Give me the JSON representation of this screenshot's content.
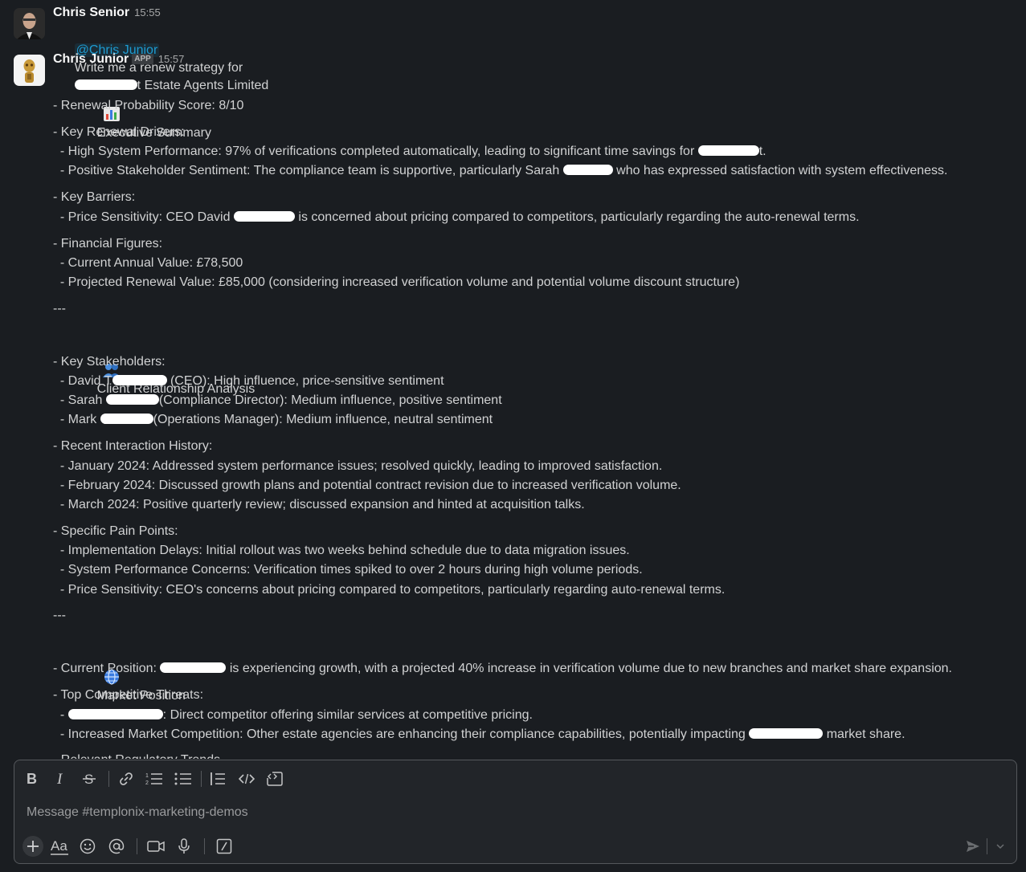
{
  "messages": [
    {
      "author": "Chris Senior",
      "time": "15:55",
      "mention": "@Chris Junior",
      "text_before": "Write me a renew strategy for",
      "text_after": "t Estate Agents Limited"
    },
    {
      "author": "Chris Junior",
      "badge": "APP",
      "time": "15:57",
      "exec_title": "Executive Summary",
      "exec_icon": "bar-chart-emoji",
      "l_prob": "- Renewal Probability Score: 8/10",
      "l_drivers": "- Key Renewal Drivers:",
      "l_driver1_a": "  - High System Performance: 97% of verifications completed automatically, leading to significant time savings for",
      "l_driver1_b": "t.",
      "l_driver2_a": "  - Positive Stakeholder Sentiment: The compliance team is supportive, particularly Sarah",
      "l_driver2_b": " who has expressed satisfaction with system effectiveness.",
      "l_barriers": "- Key Barriers:",
      "l_barrier1_a": "  - Price Sensitivity: CEO David",
      "l_barrier1_b": " is concerned about pricing compared to competitors, particularly regarding the auto-renewal terms.",
      "l_fin": "- Financial Figures:",
      "l_fin1": "  - Current Annual Value: £78,500",
      "l_fin2": "  - Projected Renewal Value: £85,000 (considering increased verification volume and potential volume discount structure)",
      "sep1": "---",
      "rel_title": "Client Relationship Analysis",
      "rel_icon": "people-emoji",
      "l_stake": "- Key Stakeholders:",
      "l_stake1_a": "  - David T",
      "l_stake1_b": " (CEO): High influence, price-sensitive sentiment",
      "l_stake2_a": "  - Sarah",
      "l_stake2_b": "(Compliance Director): Medium influence, positive sentiment",
      "l_stake3_a": "  - Mark",
      "l_stake3_b": "(Operations Manager): Medium influence, neutral sentiment",
      "l_hist": "- Recent Interaction History:",
      "l_hist1": "  - January 2024: Addressed system performance issues; resolved quickly, leading to improved satisfaction.",
      "l_hist2": "  - February 2024: Discussed growth plans and potential contract revision due to increased verification volume.",
      "l_hist3": "  - March 2024: Positive quarterly review; discussed expansion and hinted at acquisition talks.",
      "l_pain": "- Specific Pain Points:",
      "l_pain1": "  - Implementation Delays: Initial rollout was two weeks behind schedule due to data migration issues.",
      "l_pain2": "  - System Performance Concerns: Verification times spiked to over 2 hours during high volume periods.",
      "l_pain3": "  - Price Sensitivity: CEO's concerns about pricing compared to competitors, particularly regarding auto-renewal terms.",
      "sep2": "---",
      "mkt_title": "Market Position",
      "mkt_icon": "globe-emoji",
      "l_pos_a": "- Current Position:",
      "l_pos_b": " is experiencing growth, with a projected 40% increase in verification volume due to new branches and market share expansion.",
      "l_threats": "- Top Competitive Threats:",
      "l_threat1_a": "  -",
      "l_threat1_b": ": Direct competitor offering similar services at competitive pricing.",
      "l_threat2_a": "  - Increased Market Competition: Other estate agencies are enhancing their compliance capabilities, potentially impacting",
      "l_threat2_b": " market share.",
      "l_reg": "- Relevant Regulatory Trends"
    }
  ],
  "composer": {
    "placeholder": "Message #templonix-marketing-demos",
    "toolbar": [
      "bold-icon",
      "italic-icon",
      "strikethrough-icon",
      "link-icon",
      "ordered-list-icon",
      "bulleted-list-icon",
      "blockquote-icon",
      "code-icon",
      "code-block-icon"
    ],
    "bottom": [
      "plus-icon",
      "formatting-aa-icon",
      "emoji-icon",
      "mention-icon",
      "video-icon",
      "microphone-icon",
      "slash-command-icon"
    ],
    "send": "send-icon"
  },
  "colors": {
    "background": "#1a1d21",
    "text": "#d1d2d3",
    "mention": "#1d9bd1",
    "composer_border": "#55585c"
  }
}
